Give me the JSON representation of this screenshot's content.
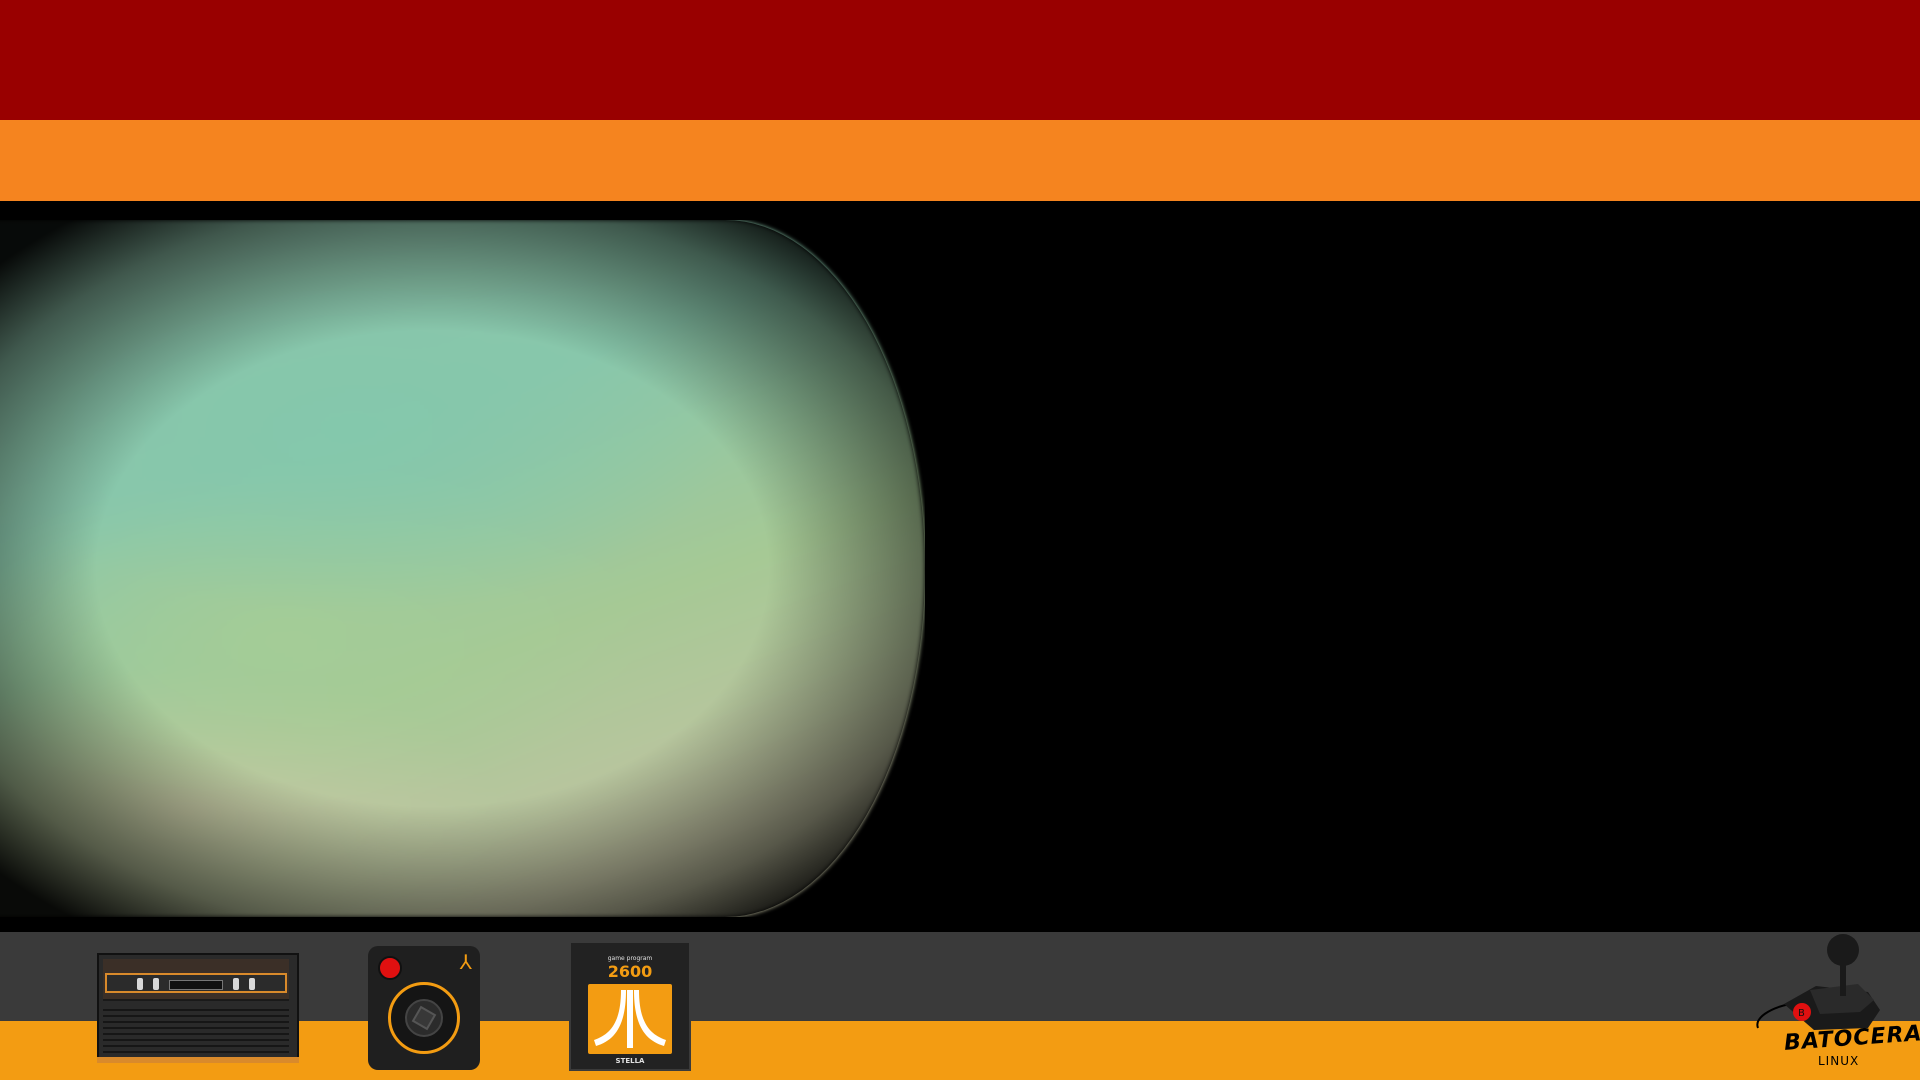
{
  "screen": {
    "state": "blank-crt-static"
  },
  "footer": {
    "items": [
      {
        "name": "console",
        "icon": "atari-2600-console-icon"
      },
      {
        "name": "controller",
        "icon": "atari-joystick-icon"
      },
      {
        "name": "cartridge",
        "icon": "atari-cartridge-icon"
      }
    ],
    "cartridge": {
      "small_text": "game program",
      "model": "2600",
      "bottom_text": "STELLA"
    },
    "brand": {
      "name": "BATOCERA",
      "sub": "LINUX"
    }
  },
  "colors": {
    "top_band": "#990000",
    "orange_band": "#f5841f",
    "gray_band": "#3a3a3a",
    "yellow_band": "#f39c12",
    "accent": "#f39c12",
    "button_red": "#e01010"
  }
}
